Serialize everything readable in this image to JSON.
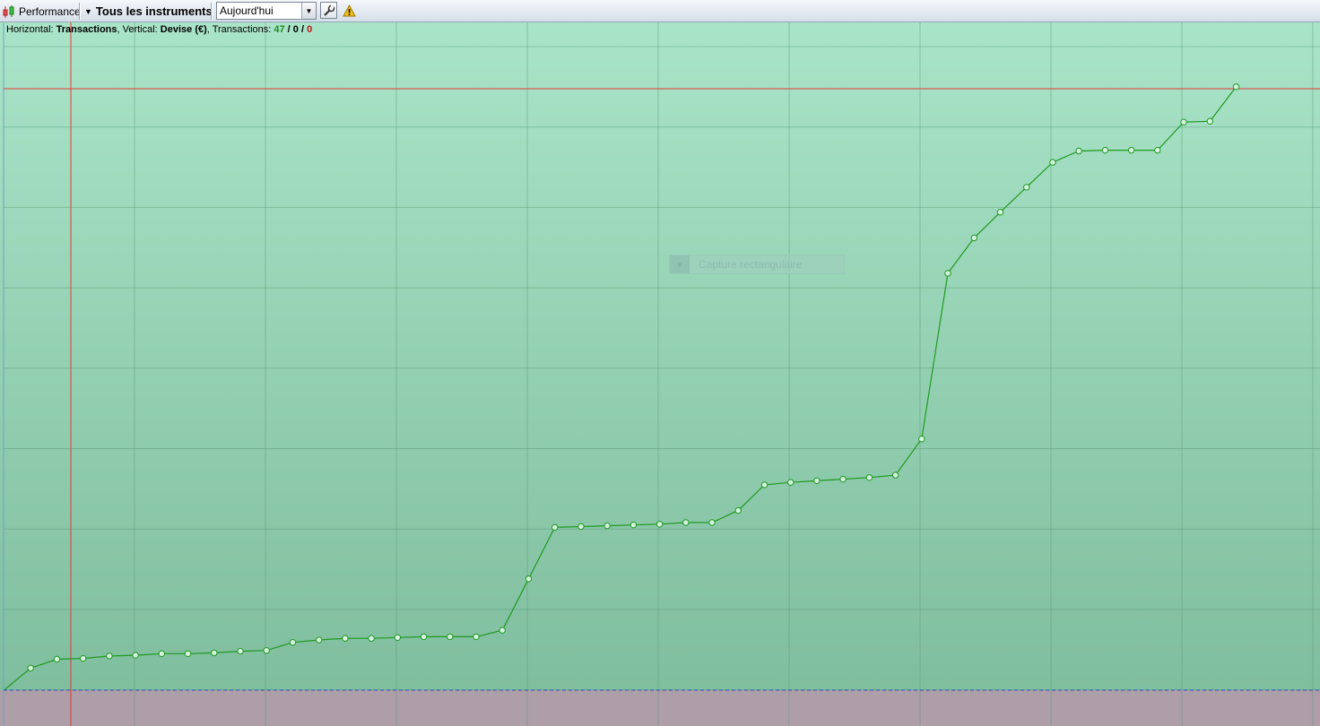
{
  "toolbar": {
    "performance_label": "Performance",
    "instruments_label": "Tous les instruments",
    "period_value": "Aujourd'hui",
    "icons": [
      "chart-candles-icon",
      "dropdown-arrow-icon",
      "wrench-icon",
      "warning-icon"
    ]
  },
  "info": {
    "horizontal_label": "Horizontal: ",
    "horizontal_value": "Transactions",
    "vertical_label": ", Vertical: ",
    "vertical_value": "Devise (€)",
    "transactions_label": ", Transactions: ",
    "count_win": "47",
    "slash1": " / ",
    "count_even": "0",
    "slash2": " / ",
    "count_loss": "0"
  },
  "overlay": {
    "capture_label": "Capture rectangulaire"
  },
  "colors": {
    "line": "#1f9a1f",
    "crosshair": "#e23a3a",
    "baseline": "#2a52c8",
    "bg_top": "#a9e4c8",
    "bg_bottom": "#7fbe9e",
    "below_zero": "#ad9ea8",
    "accent_win": "#1d8a1d",
    "accent_loss": "#c01818"
  },
  "chart_data": {
    "type": "line",
    "x": [
      0,
      1,
      2,
      3,
      4,
      5,
      6,
      7,
      8,
      9,
      10,
      11,
      12,
      13,
      14,
      15,
      16,
      17,
      18,
      19,
      20,
      21,
      22,
      23,
      24,
      25,
      26,
      27,
      28,
      29,
      30,
      31,
      32,
      33,
      34,
      35,
      36,
      37,
      38,
      39,
      40,
      41,
      42,
      43,
      44,
      45,
      46,
      47
    ],
    "values": [
      0.0,
      2.7,
      3.8,
      3.9,
      4.2,
      4.3,
      4.5,
      4.5,
      4.6,
      4.8,
      4.9,
      5.9,
      6.2,
      6.4,
      6.4,
      6.5,
      6.6,
      6.6,
      6.6,
      7.4,
      13.8,
      20.2,
      20.3,
      20.4,
      20.5,
      20.6,
      20.8,
      20.8,
      22.3,
      25.5,
      25.8,
      26.0,
      26.2,
      26.4,
      26.7,
      31.2,
      51.8,
      56.2,
      59.4,
      62.5,
      65.6,
      67.0,
      67.1,
      67.1,
      67.1,
      70.6,
      70.7,
      75.0
    ],
    "xlim": [
      0,
      50.2
    ],
    "ylim": [
      -4.5,
      83.0
    ],
    "grid": true,
    "legend": "none",
    "markers": "open-circle"
  }
}
